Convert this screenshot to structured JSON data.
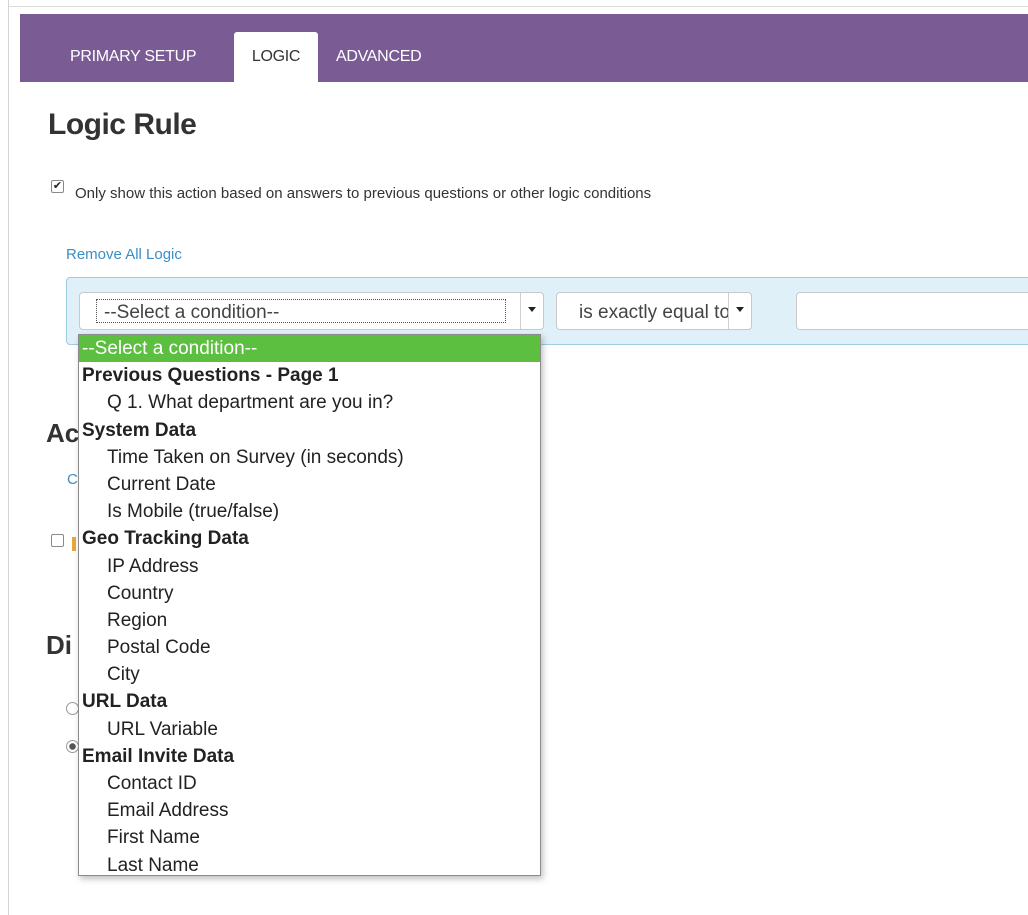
{
  "tabs": [
    {
      "label": "PRIMARY SETUP"
    },
    {
      "label": "LOGIC"
    },
    {
      "label": "ADVANCED"
    }
  ],
  "page": {
    "title": "Logic Rule",
    "checkbox_label": "Only show this action based on answers to previous questions or other logic conditions",
    "checkbox_checked": true,
    "remove_link": "Remove All Logic"
  },
  "condition": {
    "selected": "--Select a condition--",
    "operator": "is exactly equal to",
    "value": ""
  },
  "background": {
    "heading1": "Ac",
    "heading2": "Di",
    "link_fragment": "C"
  },
  "dropdown": {
    "options": [
      {
        "label": "--Select a condition--",
        "kind": "selected"
      },
      {
        "label": "Previous Questions - Page 1",
        "kind": "group"
      },
      {
        "label": "Q 1. What department are you in?",
        "kind": "item"
      },
      {
        "label": "System Data",
        "kind": "group"
      },
      {
        "label": "Time Taken on Survey (in seconds)",
        "kind": "item"
      },
      {
        "label": "Current Date",
        "kind": "item"
      },
      {
        "label": "Is Mobile (true/false)",
        "kind": "item"
      },
      {
        "label": "Geo Tracking Data",
        "kind": "group"
      },
      {
        "label": "IP Address",
        "kind": "item"
      },
      {
        "label": "Country",
        "kind": "item"
      },
      {
        "label": "Region",
        "kind": "item"
      },
      {
        "label": "Postal Code",
        "kind": "item"
      },
      {
        "label": "City",
        "kind": "item"
      },
      {
        "label": "URL Data",
        "kind": "group"
      },
      {
        "label": "URL Variable",
        "kind": "item"
      },
      {
        "label": "Email Invite Data",
        "kind": "group"
      },
      {
        "label": "Contact ID",
        "kind": "item"
      },
      {
        "label": "Email Address",
        "kind": "item"
      },
      {
        "label": "First Name",
        "kind": "item"
      },
      {
        "label": "Last Name",
        "kind": "item"
      }
    ]
  },
  "colors": {
    "header": "#7a5b94",
    "highlight": "#5cbf40",
    "link": "#3a8fc7",
    "condition_bg": "#dff0f8"
  }
}
